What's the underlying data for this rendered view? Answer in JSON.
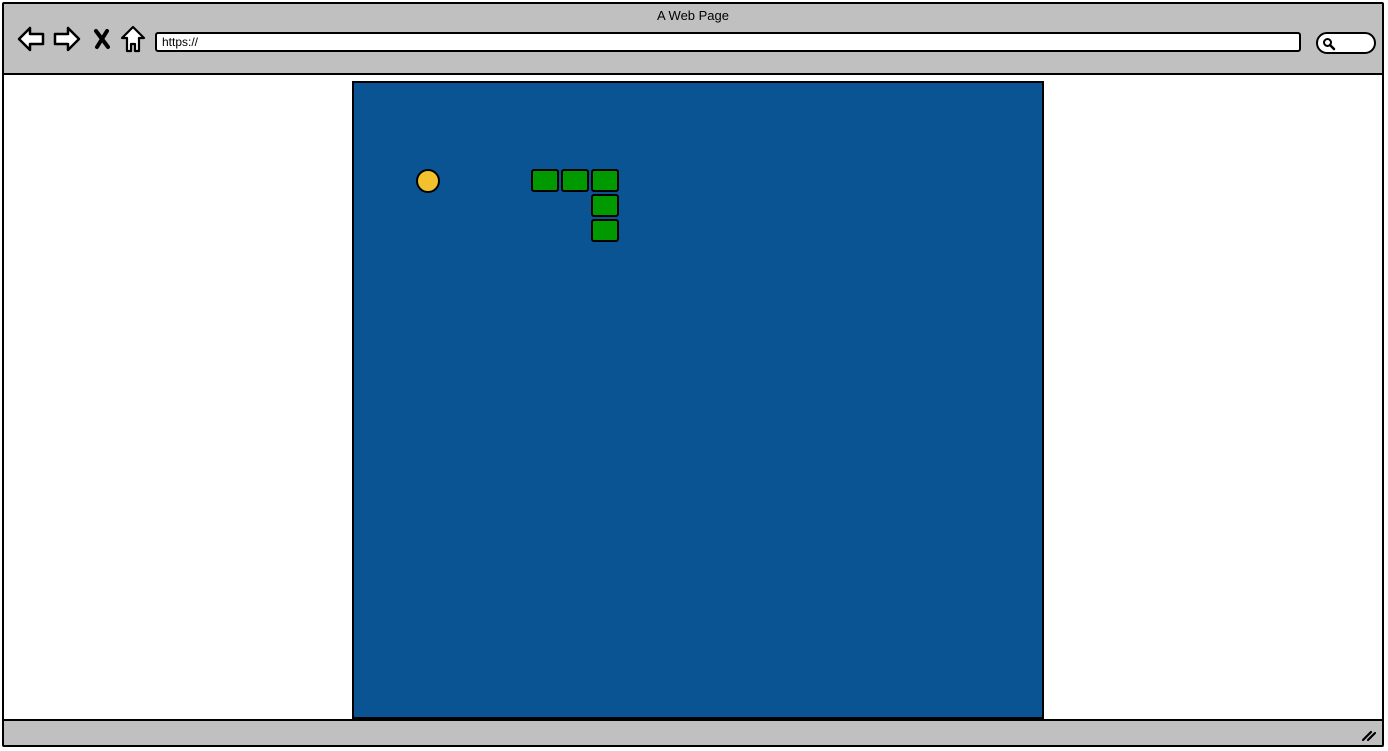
{
  "browser": {
    "title": "A Web Page",
    "url": "https://",
    "icons": {
      "back": "back-arrow-icon",
      "forward": "forward-arrow-icon",
      "stop": "close-icon",
      "home": "home-icon",
      "search": "search-icon",
      "resize": "resize-grip-icon"
    }
  },
  "game": {
    "board_color": "#0a5494",
    "snake_color": "#009900",
    "food_color": "#f2c12e"
  }
}
